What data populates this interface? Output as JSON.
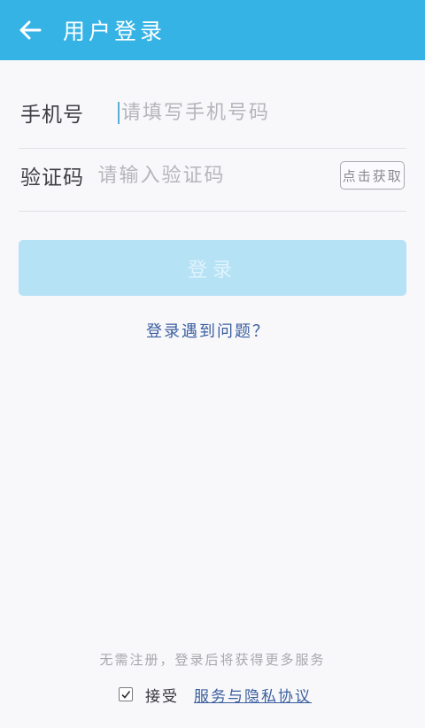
{
  "header": {
    "title": "用户登录",
    "back_icon": "arrow-left-icon",
    "color": "#36b3e5"
  },
  "form": {
    "phone": {
      "label": "手机号",
      "value": "",
      "placeholder": "请填写手机号码"
    },
    "code": {
      "label": "验证码",
      "value": "",
      "placeholder": "请输入验证码",
      "get_code_label": "点击获取"
    }
  },
  "login_button": {
    "label": "登录",
    "state": "disabled",
    "color": "#b6e2f6"
  },
  "help_link": "登录遇到问题？",
  "footer": {
    "note": "无需注册，登录后将获得更多服务",
    "accept_label": "接受",
    "agreement_link": "服务与隐私协议",
    "accept_checked": true
  }
}
